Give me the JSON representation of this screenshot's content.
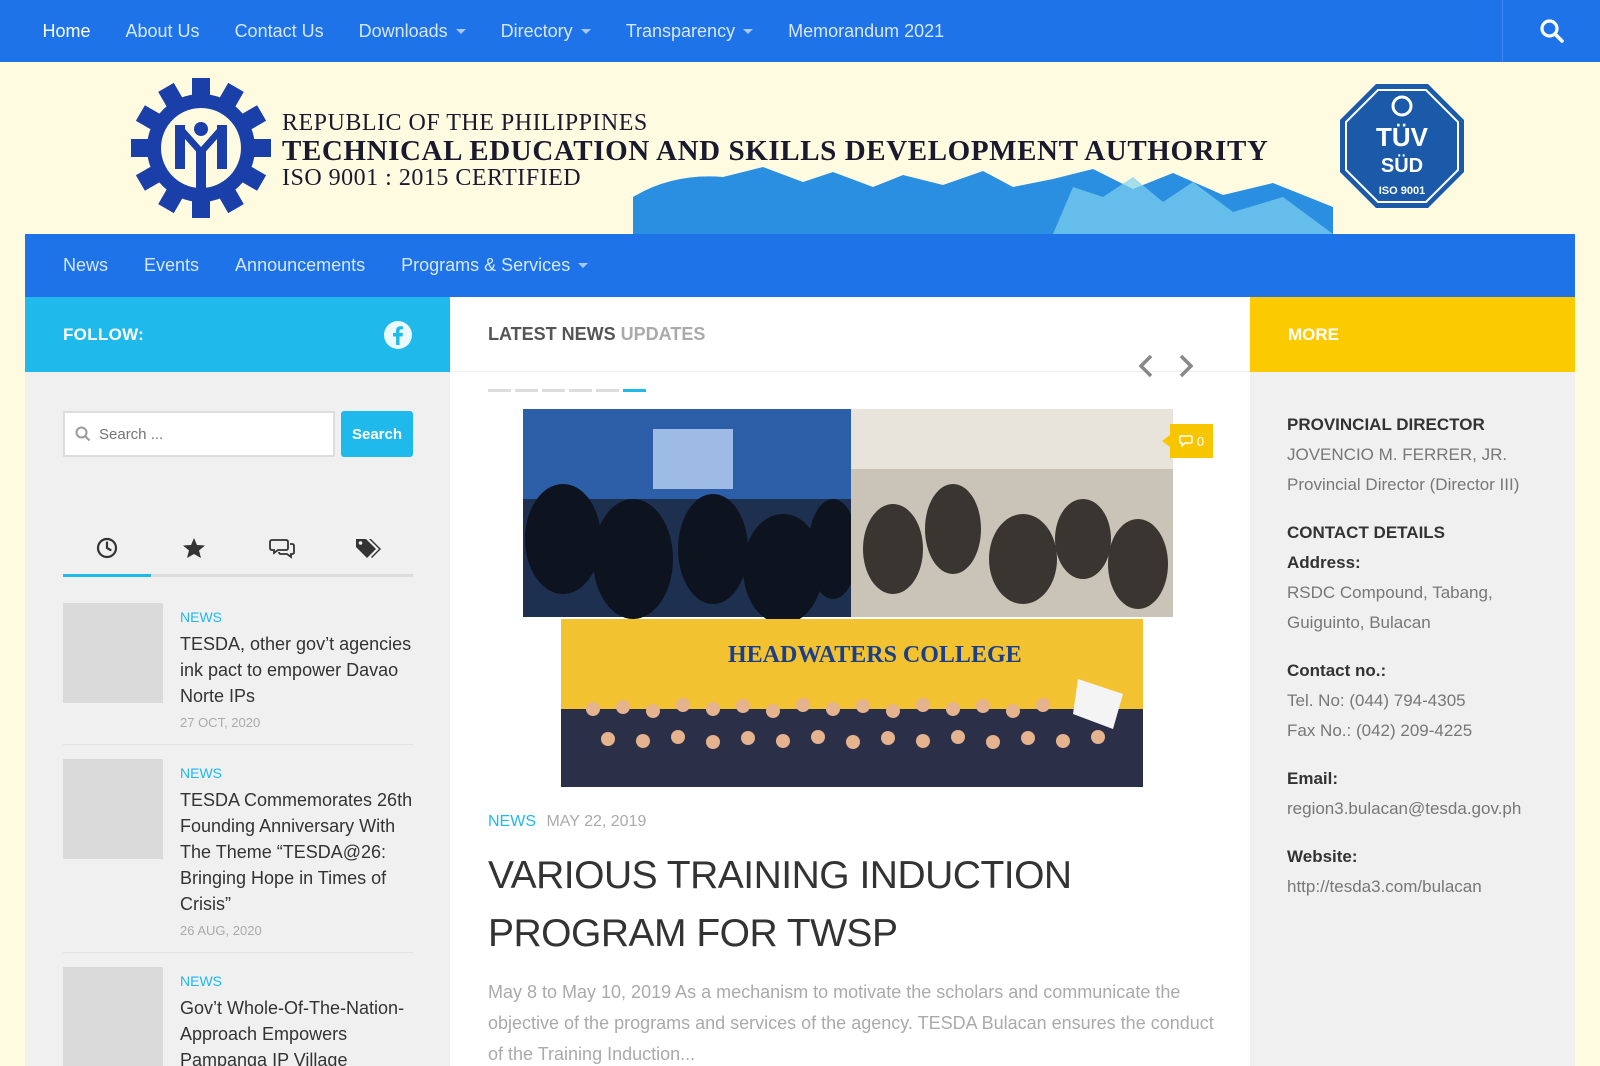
{
  "topnav": {
    "items": [
      {
        "label": "Home"
      },
      {
        "label": "About Us"
      },
      {
        "label": "Contact Us"
      },
      {
        "label": "Downloads"
      },
      {
        "label": "Directory"
      },
      {
        "label": "Transparency"
      },
      {
        "label": "Memorandum 2021"
      }
    ],
    "search_icon": "search-icon"
  },
  "header": {
    "line1": "REPUBLIC OF THE PHILIPPINES",
    "line2": "TECHNICAL EDUCATION AND SKILLS DEVELOPMENT AUTHORITY",
    "line3": "ISO 9001 : 2015 CERTIFIED",
    "badge": {
      "top": "TÜV",
      "mid": "SÜD",
      "bottom": "ISO 9001"
    }
  },
  "subnav": {
    "items": [
      {
        "label": "News"
      },
      {
        "label": "Events"
      },
      {
        "label": "Announcements"
      },
      {
        "label": "Programs & Services"
      }
    ]
  },
  "left": {
    "follow_label": "FOLLOW:",
    "search_placeholder": "Search ...",
    "search_button": "Search",
    "posts": [
      {
        "category": "NEWS",
        "title": "TESDA, other gov’t agencies ink pact to empower Davao Norte IPs",
        "date": "27 OCT, 2020"
      },
      {
        "category": "NEWS",
        "title": "TESDA Commemorates 26th Founding Anniversary With The Theme “TESDA@26: Bringing Hope in Times of Crisis”",
        "date": "26 AUG, 2020"
      },
      {
        "category": "NEWS",
        "title": "Gov’t Whole-Of-The-Nation-Approach Empowers Pampanga IP Village",
        "date": ""
      }
    ]
  },
  "main": {
    "heading_a": "LATEST NEWS",
    "heading_b": "UPDATES",
    "comment_count": "0",
    "photo_sign": "HEADWATERS COLLEGE",
    "category": "NEWS",
    "date": "MAY 22, 2019",
    "headline": "VARIOUS TRAINING INDUCTION PROGRAM FOR TWSP",
    "excerpt": "May 8 to May 10, 2019 As a mechanism to motivate the scholars and communicate the objective of the programs and services of the agency. TESDA Bulacan ensures the conduct of the Training Induction..."
  },
  "right": {
    "more_label": "MORE",
    "director_heading": "PROVINCIAL DIRECTOR",
    "director_name": "JOVENCIO M. FERRER, JR.",
    "director_title": "Provincial Director (Director III)",
    "contact_heading": "CONTACT DETAILS",
    "address_label": "Address:",
    "address_1": "RSDC Compound, Tabang,",
    "address_2": "Guiguinto, Bulacan",
    "contact_label": "Contact no.:",
    "tel": "Tel. No: (044) 794-4305",
    "fax": "Fax No.: (042) 209-4225",
    "email_label": "Email:",
    "email": "region3.bulacan@tesda.gov.ph",
    "website_label": "Website:",
    "website": "http://tesda3.com/bulacan"
  },
  "colors": {
    "blue": "#1e73e8",
    "cyan": "#20b9ec",
    "yellow": "#fcca00",
    "cream": "#fffbe1"
  }
}
